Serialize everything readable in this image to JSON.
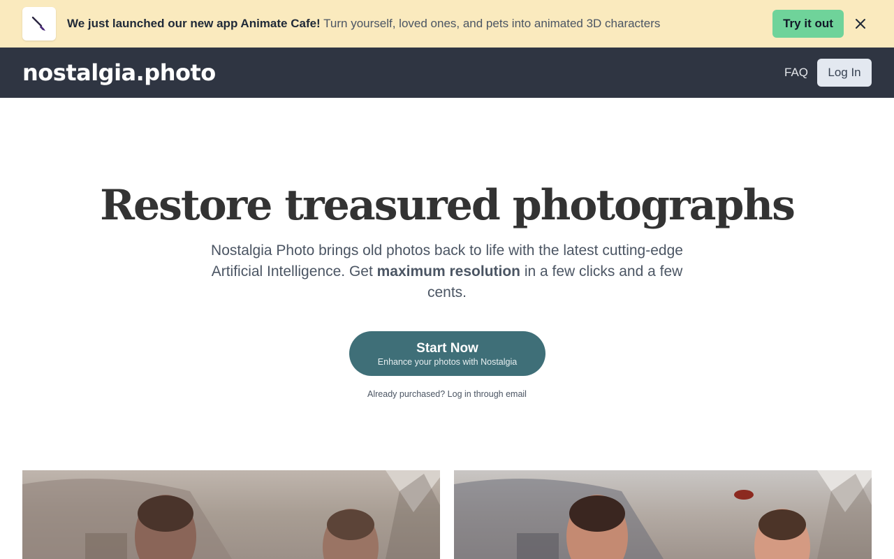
{
  "banner": {
    "icon": "paintbrush-icon",
    "headline": "We just launched our new app Animate Cafe!",
    "description": "Turn yourself, loved ones, and pets into animated 3D characters",
    "cta_label": "Try it out",
    "close_icon": "close-icon",
    "background": "#faeabe",
    "cta_color": "#6fd39a"
  },
  "header": {
    "logo": "nostalgia.photo",
    "nav": {
      "faq_label": "FAQ",
      "login_label": "Log In"
    },
    "background": "#2f3542"
  },
  "hero": {
    "title": "Restore treasured photographs",
    "subtitle_before": "Nostalgia Photo brings old photos back to life with the latest cutting-edge Artificial Intelligence. Get ",
    "subtitle_bold": "maximum resolution",
    "subtitle_after": " in a few clicks and a few cents.",
    "cta_title": "Start Now",
    "cta_subtitle": "Enhance your photos with Nostalgia",
    "cta_color": "#3f6f78",
    "login_hint": "Already purchased? Log in through email"
  },
  "photos": {
    "before_label": "",
    "after_label": ""
  }
}
